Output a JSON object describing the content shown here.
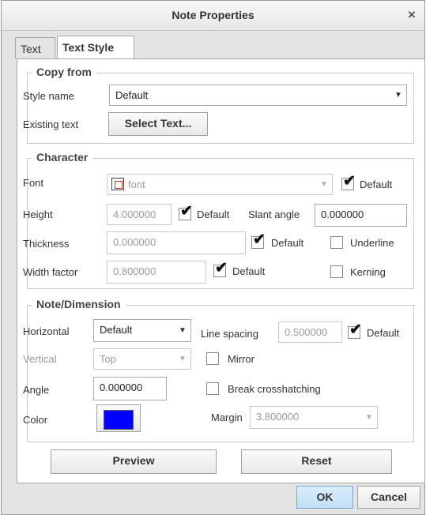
{
  "window": {
    "title": "Note Properties",
    "close_glyph": "×"
  },
  "tabs": [
    {
      "label": "Text"
    },
    {
      "label": "Text Style"
    }
  ],
  "copy_from": {
    "legend": "Copy from",
    "style_name_label": "Style name",
    "style_name_value": "Default",
    "existing_text_label": "Existing text",
    "select_text_button": "Select Text..."
  },
  "character": {
    "legend": "Character",
    "font_label": "Font",
    "font_value": "font",
    "font_default_label": "Default",
    "font_default_checked": true,
    "height_label": "Height",
    "height_value": "4.000000",
    "height_default_label": "Default",
    "height_default_checked": true,
    "slant_label": "Slant angle",
    "slant_value": "0.000000",
    "thickness_label": "Thickness",
    "thickness_value": "0.000000",
    "thickness_default_label": "Default",
    "thickness_default_checked": true,
    "underline_label": "Underline",
    "underline_checked": false,
    "width_label": "Width factor",
    "width_value": "0.800000",
    "width_default_label": "Default",
    "width_default_checked": true,
    "kerning_label": "Kerning",
    "kerning_checked": false
  },
  "note_dimension": {
    "legend": "Note/Dimension",
    "horizontal_label": "Horizontal",
    "horizontal_value": "Default",
    "line_spacing_label": "Line spacing",
    "line_spacing_value": "0.500000",
    "line_spacing_default_label": "Default",
    "line_spacing_default_checked": true,
    "vertical_label": "Vertical",
    "vertical_value": "Top",
    "mirror_label": "Mirror",
    "mirror_checked": false,
    "angle_label": "Angle",
    "angle_value": "0.000000",
    "break_label": "Break crosshatching",
    "break_checked": false,
    "color_label": "Color",
    "color_value": "#0000ff",
    "margin_label": "Margin",
    "margin_value": "3.800000"
  },
  "buttons": {
    "preview": "Preview",
    "reset": "Reset",
    "ok": "OK",
    "cancel": "Cancel"
  },
  "icons": {
    "dropdown": "▼",
    "checkmark": "✔"
  }
}
